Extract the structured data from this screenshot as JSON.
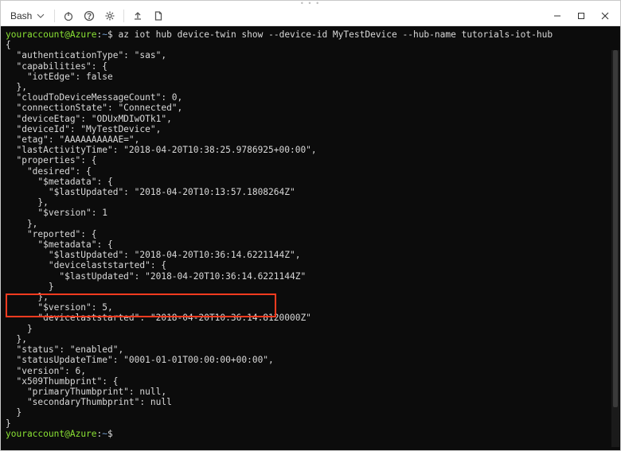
{
  "titlebar": {
    "shell_label": "Bash",
    "drag_dots": "• • •"
  },
  "prompt": {
    "user": "youraccount",
    "at": "@",
    "host": "Azure",
    "colon": ":",
    "path": "~",
    "sigil": "$"
  },
  "command": " az iot hub device-twin show --device-id MyTestDevice --hub-name tutorials-iot-hub",
  "output": {
    "l00": "{",
    "l01": "  \"authenticationType\": \"sas\",",
    "l02": "  \"capabilities\": {",
    "l03": "    \"iotEdge\": false",
    "l04": "  },",
    "l05": "  \"cloudToDeviceMessageCount\": 0,",
    "l06": "  \"connectionState\": \"Connected\",",
    "l07": "  \"deviceEtag\": \"ODUxMDIwOTk1\",",
    "l08": "  \"deviceId\": \"MyTestDevice\",",
    "l09": "  \"etag\": \"AAAAAAAAAAE=\",",
    "l10": "  \"lastActivityTime\": \"2018-04-20T10:38:25.9786925+00:00\",",
    "l11": "  \"properties\": {",
    "l12": "    \"desired\": {",
    "l13": "      \"$metadata\": {",
    "l14": "        \"$lastUpdated\": \"2018-04-20T10:13:57.1808264Z\"",
    "l15": "      },",
    "l16": "      \"$version\": 1",
    "l17": "    },",
    "l18": "    \"reported\": {",
    "l19": "      \"$metadata\": {",
    "l20": "        \"$lastUpdated\": \"2018-04-20T10:36:14.6221144Z\",",
    "l21": "        \"devicelaststarted\": {",
    "l22": "          \"$lastUpdated\": \"2018-04-20T10:36:14.6221144Z\"",
    "l23": "        }",
    "l24": "      },",
    "l25": "      \"$version\": 5,",
    "l26": "      \"devicelaststarted\": \"2018-04-20T10:36:14.8120000Z\"",
    "l27": "    }",
    "l28": "  },",
    "l29": "  \"status\": \"enabled\",",
    "l30": "  \"statusUpdateTime\": \"0001-01-01T00:00:00+00:00\",",
    "l31": "  \"version\": 6,",
    "l32": "  \"x509Thumbprint\": {",
    "l33": "    \"primaryThumbprint\": null,",
    "l34": "    \"secondaryThumbprint\": null",
    "l35": "  }",
    "l36": "}"
  },
  "icons": {
    "power": "power-icon",
    "help": "help-icon",
    "settings": "gear-icon",
    "upload": "upload-icon",
    "newfile": "new-file-icon",
    "chevron": "chevron-down-icon",
    "minimize": "minimize-icon",
    "maximize": "maximize-icon",
    "close": "close-icon"
  }
}
